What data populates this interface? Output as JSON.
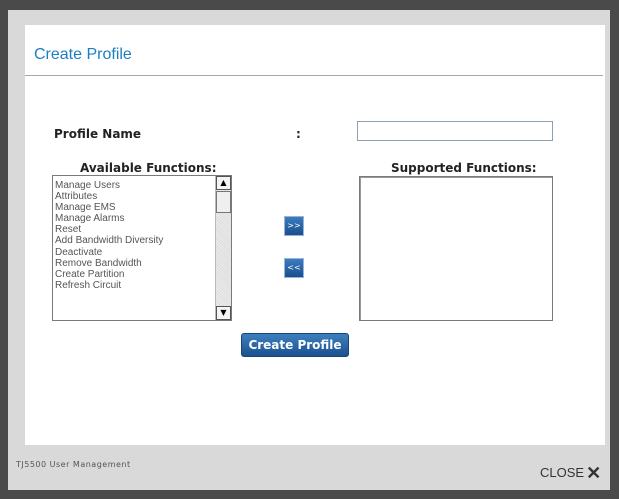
{
  "dialog": {
    "title": "Create Profile",
    "profile_name_label": "Profile Name",
    "profile_name_separator": ":",
    "profile_name_value": "",
    "available_label": "Available Functions:",
    "supported_label": "Supported Functions:",
    "available_functions": [
      "Manage Users",
      "Attributes",
      "Manage EMS",
      "Manage Alarms",
      "Reset",
      "Add Bandwidth Diversity",
      "Deactivate",
      "Remove Bandwidth",
      "Create Partition",
      "Refresh Circuit"
    ],
    "supported_functions": [],
    "add_button_label": ">>",
    "remove_button_label": "<<",
    "create_button_label": "Create Profile"
  },
  "footer": {
    "app_name": "TJ5500 User Management",
    "close_label": "CLOSE",
    "close_icon": "close-icon"
  },
  "colors": {
    "title": "#1b7fc0",
    "button": "#1b5190"
  }
}
